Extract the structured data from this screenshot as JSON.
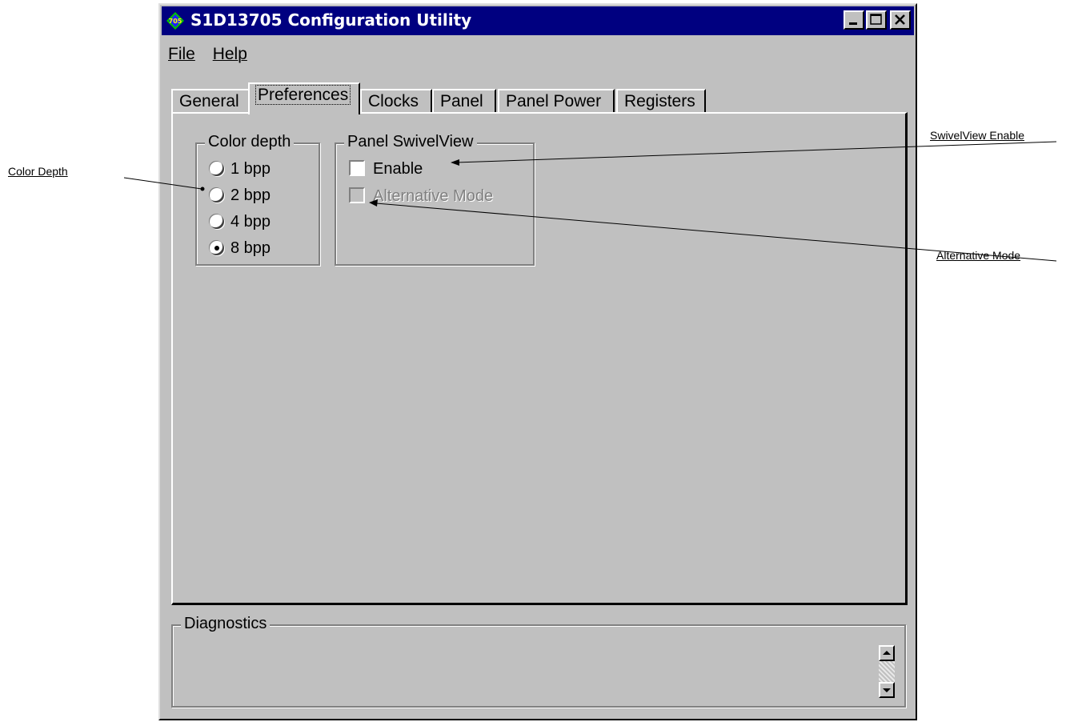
{
  "window": {
    "title": "S1D13705 Configuration Utility",
    "app_icon_text": "705",
    "title_bar_color": "#000080",
    "face_color": "#c0c0c0"
  },
  "menu": {
    "file": "File",
    "help": "Help"
  },
  "tabs": [
    "General",
    "Preferences",
    "Clocks",
    "Panel",
    "Panel Power",
    "Registers"
  ],
  "active_tab": "Preferences",
  "color_depth": {
    "legend": "Color depth",
    "options": [
      "1 bpp",
      "2 bpp",
      "4 bpp",
      "8 bpp"
    ],
    "selected": "8 bpp"
  },
  "swivelview": {
    "legend": "Panel SwivelView",
    "enable_label": "Enable",
    "enable_checked": false,
    "alt_mode_label": "Alternative Mode",
    "alt_mode_enabled": false
  },
  "diagnostics": {
    "legend": "Diagnostics"
  },
  "annotations": {
    "color_depth": "Color Depth",
    "swivelview_enable": "SwivelView Enable",
    "alternative_mode": "Alternative Mode"
  }
}
